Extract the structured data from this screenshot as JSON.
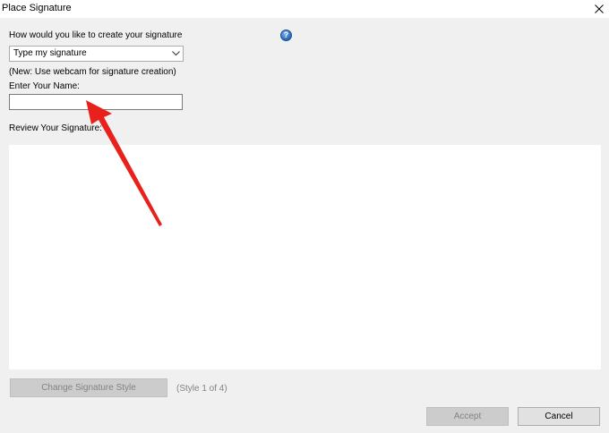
{
  "window": {
    "title": "Place Signature",
    "close_icon": "close-icon"
  },
  "form": {
    "method_label": "How would you like to create your signature",
    "help_icon": "help-icon",
    "help_glyph": "?",
    "method_selected": "Type my signature",
    "webcam_note": "(New: Use webcam for signature creation)",
    "name_label": "Enter Your Name:",
    "name_value": "",
    "review_label": "Review Your Signature:"
  },
  "actions": {
    "change_style_label": "Change Signature Style",
    "style_count": "(Style 1 of 4)",
    "accept_label": "Accept",
    "cancel_label": "Cancel"
  },
  "annotation": {
    "arrow_color": "#e8211d"
  },
  "colors": {
    "dialog_bg": "#f0f0f0",
    "titlebar_bg": "#ffffff",
    "disabled_text": "#838383"
  }
}
